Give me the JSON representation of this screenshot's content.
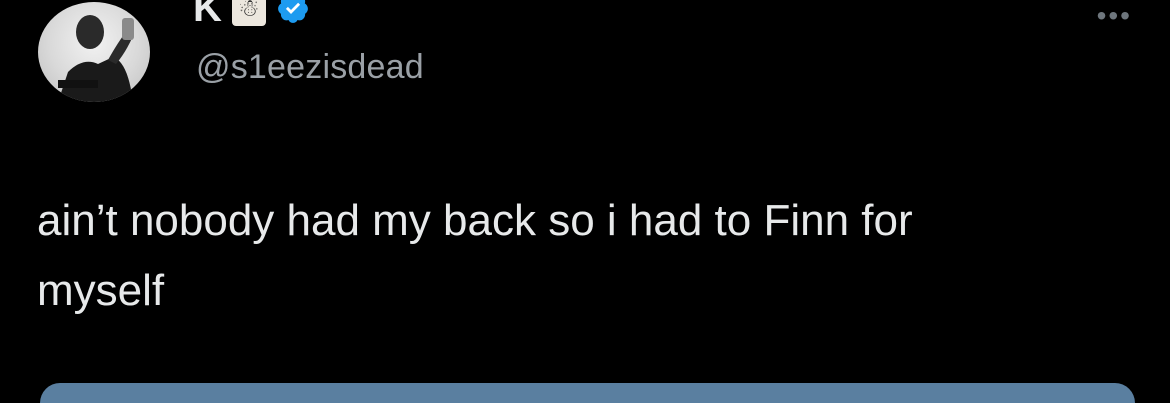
{
  "tweet": {
    "display_name": "K",
    "handle": "@s1eezisdead",
    "text_line1": "ain’t nobody had my back so i had to Finn for",
    "text_line2": "myself",
    "more_label": "•••"
  },
  "icons": {
    "avatar": "profile-photo",
    "badge": "emoji-badge-icon",
    "verified": "verified-badge-icon",
    "more": "more-options-icon"
  },
  "colors": {
    "background": "#000000",
    "text": "#e7e9ea",
    "secondary": "#9aa0a6",
    "verified": "#1d9bf0"
  }
}
